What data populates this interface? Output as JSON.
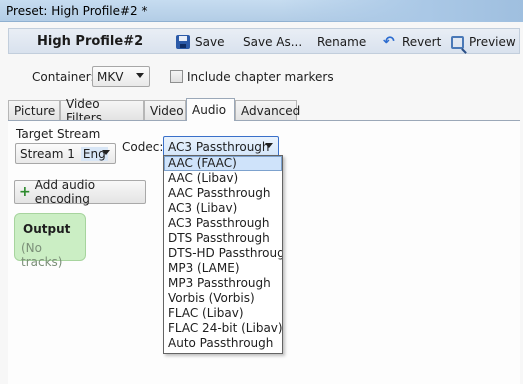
{
  "window": {
    "title": "Preset: High Profile#2 *"
  },
  "toolbar": {
    "profile_name": "High Profile#2",
    "save": "Save",
    "save_as": "Save As...",
    "rename": "Rename",
    "revert": "Revert",
    "preview": "Preview"
  },
  "container": {
    "label": "Container:",
    "value": "MKV",
    "chapter_markers_label": "Include chapter markers",
    "chapter_markers_checked": false
  },
  "tabs": [
    {
      "label": "Picture"
    },
    {
      "label": "Video Filters"
    },
    {
      "label": "Video"
    },
    {
      "label": "Audio",
      "active": true
    },
    {
      "label": "Advanced"
    }
  ],
  "audio": {
    "target_stream_label": "Target Stream",
    "stream_value": "Stream 1",
    "stream_lang": "Eng",
    "codec_label": "Codec:",
    "codec_value": "AC3 Passthrough",
    "codec_options": [
      "AAC (FAAC)",
      "AAC (Libav)",
      "AAC Passthrough",
      "AC3 (Libav)",
      "AC3 Passthrough",
      "DTS Passthrough",
      "DTS-HD Passthrough",
      "MP3 (LAME)",
      "MP3 Passthrough",
      "Vorbis (Vorbis)",
      "FLAC (Libav)",
      "FLAC 24-bit (Libav)",
      "Auto Passthrough"
    ],
    "highlighted_option": "AAC (FAAC)",
    "add_button": "Add audio encoding",
    "output_title": "Output",
    "output_subtitle": "(No tracks)"
  },
  "colors": {
    "accent": "#3a70c9",
    "output_card": "#cbeec4",
    "highlight": "#cfe3fa"
  },
  "icons": [
    "save-icon",
    "revert-icon",
    "preview-icon",
    "plus-icon",
    "chevron-down-icon"
  ]
}
